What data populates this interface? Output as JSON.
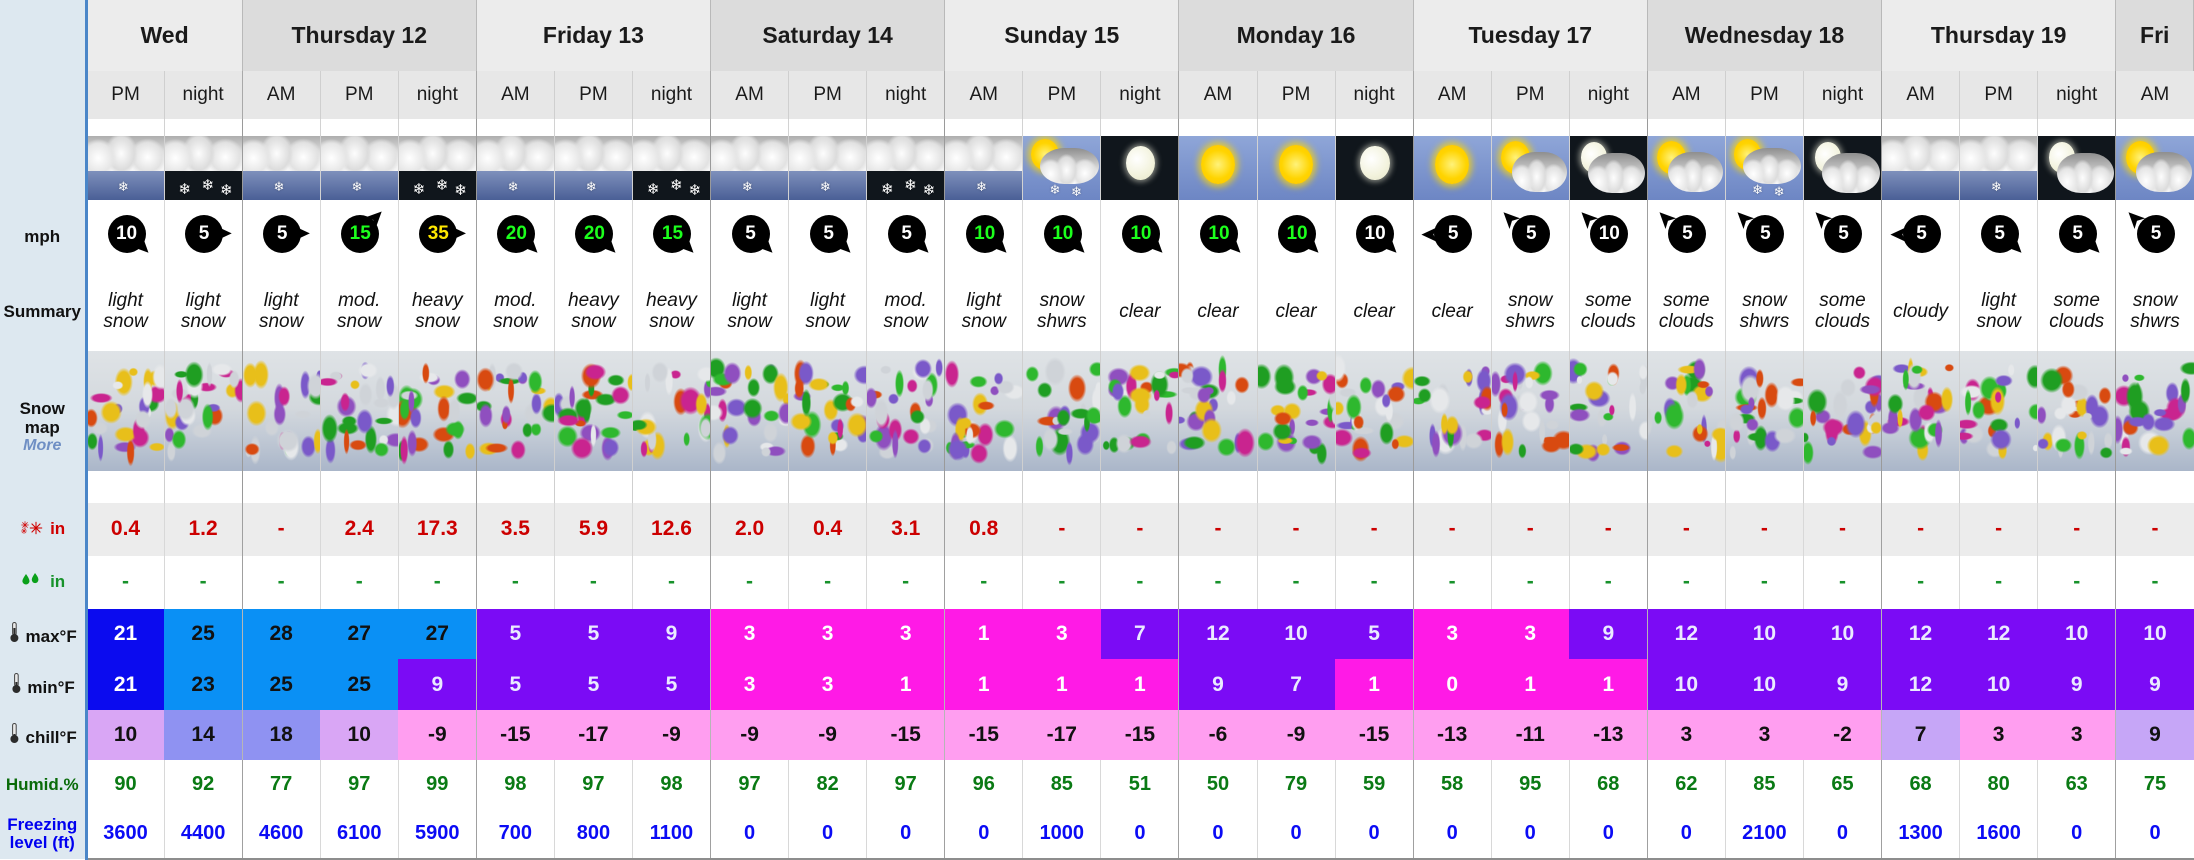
{
  "sidebar": {
    "wind_label": "mph",
    "summary_label": "Summary",
    "snowmap_label": "Snow map",
    "snowmap_more": "More",
    "snow_amount_label": "in",
    "rain_amount_label": "in",
    "max_temp_label": "max°F",
    "min_temp_label": "min°F",
    "chill_label": "chill°F",
    "humidity_label": "Humid.%",
    "freezing_label_1": "Freezing",
    "freezing_label_2": "level (ft)"
  },
  "days": [
    {
      "label": "Wed",
      "span": 2,
      "shade": "a"
    },
    {
      "label": "Thursday 12",
      "span": 3,
      "shade": "b"
    },
    {
      "label": "Friday 13",
      "span": 3,
      "shade": "a"
    },
    {
      "label": "Saturday 14",
      "span": 3,
      "shade": "b"
    },
    {
      "label": "Sunday 15",
      "span": 3,
      "shade": "a"
    },
    {
      "label": "Monday 16",
      "span": 3,
      "shade": "b"
    },
    {
      "label": "Tuesday 17",
      "span": 3,
      "shade": "a"
    },
    {
      "label": "Wednesday 18",
      "span": 3,
      "shade": "b"
    },
    {
      "label": "Thursday 19",
      "span": 3,
      "shade": "a"
    },
    {
      "label": "Fri",
      "span": 1,
      "shade": "b"
    }
  ],
  "columns": [
    {
      "period": "PM",
      "group_start": true,
      "sky": "snow-day",
      "wind": 10,
      "wind_color": "white",
      "wind_dir": "SE",
      "summary": [
        "light",
        "snow"
      ],
      "snow": "0.4",
      "rain": "-",
      "max": 21,
      "min": 21,
      "chill": 10,
      "humid": 90,
      "freeze": 3600,
      "max_bg": "#0b0bef",
      "min_bg": "#0b0bef",
      "max_fg": "#ffffff",
      "min_fg": "#ffffff",
      "chill_bg": "#d9a6f5",
      "chill_fg": "#111111"
    },
    {
      "period": "night",
      "group_start": false,
      "sky": "snow-night",
      "wind": 5,
      "wind_color": "white",
      "wind_dir": "E",
      "summary": [
        "light",
        "snow"
      ],
      "snow": "1.2",
      "rain": "-",
      "max": 25,
      "min": 23,
      "chill": 14,
      "humid": 92,
      "freeze": 4400,
      "max_bg": "#0a90f5",
      "min_bg": "#0a90f5",
      "max_fg": "#111111",
      "min_fg": "#111111",
      "chill_bg": "#8f92f2",
      "chill_fg": "#111111"
    },
    {
      "period": "AM",
      "group_start": true,
      "sky": "snow-day",
      "wind": 5,
      "wind_color": "white",
      "wind_dir": "E",
      "summary": [
        "light",
        "snow"
      ],
      "snow": "-",
      "rain": "-",
      "max": 28,
      "min": 25,
      "chill": 18,
      "humid": 77,
      "freeze": 4600,
      "max_bg": "#0a90f5",
      "min_bg": "#0a90f5",
      "max_fg": "#111111",
      "min_fg": "#111111",
      "chill_bg": "#8f92f2",
      "chill_fg": "#111111"
    },
    {
      "period": "PM",
      "group_start": false,
      "sky": "snow-day",
      "wind": 15,
      "wind_color": "green",
      "wind_dir": "NE",
      "summary": [
        "mod.",
        "snow"
      ],
      "snow": "2.4",
      "rain": "-",
      "max": 27,
      "min": 25,
      "chill": 10,
      "humid": 97,
      "freeze": 6100,
      "max_bg": "#0a90f5",
      "min_bg": "#0a90f5",
      "max_fg": "#111111",
      "min_fg": "#111111",
      "chill_bg": "#d9a6f5",
      "chill_fg": "#111111"
    },
    {
      "period": "night",
      "group_start": false,
      "sky": "snow-night",
      "wind": 35,
      "wind_color": "yellow",
      "wind_dir": "E",
      "summary": [
        "heavy",
        "snow"
      ],
      "snow": "17.3",
      "rain": "-",
      "max": 27,
      "min": 9,
      "chill": -9,
      "humid": 99,
      "freeze": 5900,
      "max_bg": "#0a90f5",
      "min_bg": "#7b0bf5",
      "max_fg": "#111111",
      "min_fg": "#eaeaff",
      "chill_bg": "#ff9ef0",
      "chill_fg": "#111111"
    },
    {
      "period": "AM",
      "group_start": true,
      "sky": "snow-day",
      "wind": 20,
      "wind_color": "green",
      "wind_dir": "SE",
      "summary": [
        "mod.",
        "snow"
      ],
      "snow": "3.5",
      "rain": "-",
      "max": 5,
      "min": 5,
      "chill": -15,
      "humid": 98,
      "freeze": 700,
      "max_bg": "#7b0bf5",
      "min_bg": "#7b0bf5",
      "max_fg": "#eaeaff",
      "min_fg": "#eaeaff",
      "chill_bg": "#ff9ef0",
      "chill_fg": "#111111"
    },
    {
      "period": "PM",
      "group_start": false,
      "sky": "snow-day",
      "wind": 20,
      "wind_color": "green",
      "wind_dir": "SE",
      "summary": [
        "heavy",
        "snow"
      ],
      "snow": "5.9",
      "rain": "-",
      "max": 5,
      "min": 5,
      "chill": -17,
      "humid": 97,
      "freeze": 800,
      "max_bg": "#7b0bf5",
      "min_bg": "#7b0bf5",
      "max_fg": "#eaeaff",
      "min_fg": "#eaeaff",
      "chill_bg": "#ff9ef0",
      "chill_fg": "#111111"
    },
    {
      "period": "night",
      "group_start": false,
      "sky": "snow-night",
      "wind": 15,
      "wind_color": "green",
      "wind_dir": "SE",
      "summary": [
        "heavy",
        "snow"
      ],
      "snow": "12.6",
      "rain": "-",
      "max": 9,
      "min": 5,
      "chill": -9,
      "humid": 98,
      "freeze": 1100,
      "max_bg": "#7b0bf5",
      "min_bg": "#7b0bf5",
      "max_fg": "#eaeaff",
      "min_fg": "#eaeaff",
      "chill_bg": "#ff9ef0",
      "chill_fg": "#111111"
    },
    {
      "period": "AM",
      "group_start": true,
      "sky": "snow-day",
      "wind": 5,
      "wind_color": "white",
      "wind_dir": "SE",
      "summary": [
        "light",
        "snow"
      ],
      "snow": "2.0",
      "rain": "-",
      "max": 3,
      "min": 3,
      "chill": -9,
      "humid": 97,
      "freeze": 0,
      "max_bg": "#ff1ae6",
      "min_bg": "#ff1ae6",
      "max_fg": "#ffffff",
      "min_fg": "#ffffff",
      "chill_bg": "#ff9ef0",
      "chill_fg": "#111111"
    },
    {
      "period": "PM",
      "group_start": false,
      "sky": "snow-day",
      "wind": 5,
      "wind_color": "white",
      "wind_dir": "SE",
      "summary": [
        "light",
        "snow"
      ],
      "snow": "0.4",
      "rain": "-",
      "max": 3,
      "min": 3,
      "chill": -9,
      "humid": 82,
      "freeze": 0,
      "max_bg": "#ff1ae6",
      "min_bg": "#ff1ae6",
      "max_fg": "#ffffff",
      "min_fg": "#ffffff",
      "chill_bg": "#ff9ef0",
      "chill_fg": "#111111"
    },
    {
      "period": "night",
      "group_start": false,
      "sky": "snow-night",
      "wind": 5,
      "wind_color": "white",
      "wind_dir": "SE",
      "summary": [
        "mod.",
        "snow"
      ],
      "snow": "3.1",
      "rain": "-",
      "max": 3,
      "min": 1,
      "chill": -15,
      "humid": 97,
      "freeze": 0,
      "max_bg": "#ff1ae6",
      "min_bg": "#ff1ae6",
      "max_fg": "#ffffff",
      "min_fg": "#ffffff",
      "chill_bg": "#ff9ef0",
      "chill_fg": "#111111"
    },
    {
      "period": "AM",
      "group_start": true,
      "sky": "snow-day",
      "wind": 10,
      "wind_color": "green",
      "wind_dir": "SE",
      "summary": [
        "light",
        "snow"
      ],
      "snow": "0.8",
      "rain": "-",
      "max": 1,
      "min": 1,
      "chill": -15,
      "humid": 96,
      "freeze": 0,
      "max_bg": "#ff1ae6",
      "min_bg": "#ff1ae6",
      "max_fg": "#ffffff",
      "min_fg": "#ffffff",
      "chill_bg": "#ff9ef0",
      "chill_fg": "#111111"
    },
    {
      "period": "PM",
      "group_start": false,
      "sky": "sun-snow",
      "wind": 10,
      "wind_color": "green",
      "wind_dir": "SE",
      "summary": [
        "snow",
        "shwrs"
      ],
      "snow": "-",
      "rain": "-",
      "max": 3,
      "min": 1,
      "chill": -17,
      "humid": 85,
      "freeze": 1000,
      "max_bg": "#ff1ae6",
      "min_bg": "#ff1ae6",
      "max_fg": "#ffffff",
      "min_fg": "#ffffff",
      "chill_bg": "#ff9ef0",
      "chill_fg": "#111111"
    },
    {
      "period": "night",
      "group_start": false,
      "sky": "moon-clear",
      "wind": 10,
      "wind_color": "green",
      "wind_dir": "SE",
      "summary": [
        "clear"
      ],
      "snow": "-",
      "rain": "-",
      "max": 7,
      "min": 1,
      "chill": -15,
      "humid": 51,
      "freeze": 0,
      "max_bg": "#7b0bf5",
      "min_bg": "#ff1ae6",
      "max_fg": "#eaeaff",
      "min_fg": "#ffffff",
      "chill_bg": "#ff9ef0",
      "chill_fg": "#111111"
    },
    {
      "period": "AM",
      "group_start": true,
      "sky": "sun-clear",
      "wind": 10,
      "wind_color": "green",
      "wind_dir": "SE",
      "summary": [
        "clear"
      ],
      "snow": "-",
      "rain": "-",
      "max": 12,
      "min": 9,
      "chill": -6,
      "humid": 50,
      "freeze": 0,
      "max_bg": "#7b0bf5",
      "min_bg": "#7b0bf5",
      "max_fg": "#eaeaff",
      "min_fg": "#eaeaff",
      "chill_bg": "#ff9ef0",
      "chill_fg": "#111111"
    },
    {
      "period": "PM",
      "group_start": false,
      "sky": "sun-clear",
      "wind": 10,
      "wind_color": "green",
      "wind_dir": "SE",
      "summary": [
        "clear"
      ],
      "snow": "-",
      "rain": "-",
      "max": 10,
      "min": 7,
      "chill": -9,
      "humid": 79,
      "freeze": 0,
      "max_bg": "#7b0bf5",
      "min_bg": "#7b0bf5",
      "max_fg": "#eaeaff",
      "min_fg": "#eaeaff",
      "chill_bg": "#ff9ef0",
      "chill_fg": "#111111"
    },
    {
      "period": "night",
      "group_start": false,
      "sky": "moon-clear",
      "wind": 10,
      "wind_color": "white",
      "wind_dir": "SE",
      "summary": [
        "clear"
      ],
      "snow": "-",
      "rain": "-",
      "max": 5,
      "min": 1,
      "chill": -15,
      "humid": 59,
      "freeze": 0,
      "max_bg": "#7b0bf5",
      "min_bg": "#ff1ae6",
      "max_fg": "#eaeaff",
      "min_fg": "#ffffff",
      "chill_bg": "#ff9ef0",
      "chill_fg": "#111111"
    },
    {
      "period": "AM",
      "group_start": true,
      "sky": "sun-clear",
      "wind": 5,
      "wind_color": "white",
      "wind_dir": "W",
      "summary": [
        "clear"
      ],
      "snow": "-",
      "rain": "-",
      "max": 3,
      "min": 0,
      "chill": -13,
      "humid": 58,
      "freeze": 0,
      "max_bg": "#ff1ae6",
      "min_bg": "#ff1ae6",
      "max_fg": "#ffffff",
      "min_fg": "#ffffff",
      "chill_bg": "#ff9ef0",
      "chill_fg": "#111111"
    },
    {
      "period": "PM",
      "group_start": false,
      "sky": "sun-cloud",
      "wind": 5,
      "wind_color": "white",
      "wind_dir": "NW",
      "summary": [
        "snow",
        "shwrs"
      ],
      "snow": "-",
      "rain": "-",
      "max": 3,
      "min": 1,
      "chill": -11,
      "humid": 95,
      "freeze": 0,
      "max_bg": "#ff1ae6",
      "min_bg": "#ff1ae6",
      "max_fg": "#ffffff",
      "min_fg": "#ffffff",
      "chill_bg": "#ff9ef0",
      "chill_fg": "#111111"
    },
    {
      "period": "night",
      "group_start": false,
      "sky": "moon-cloud",
      "wind": 10,
      "wind_color": "white",
      "wind_dir": "NW",
      "summary": [
        "some",
        "clouds"
      ],
      "snow": "-",
      "rain": "-",
      "max": 9,
      "min": 1,
      "chill": -13,
      "humid": 68,
      "freeze": 0,
      "max_bg": "#7b0bf5",
      "min_bg": "#ff1ae6",
      "max_fg": "#eaeaff",
      "min_fg": "#ffffff",
      "chill_bg": "#ff9ef0",
      "chill_fg": "#111111"
    },
    {
      "period": "AM",
      "group_start": true,
      "sky": "sun-cloud",
      "wind": 5,
      "wind_color": "white",
      "wind_dir": "NW",
      "summary": [
        "some",
        "clouds"
      ],
      "snow": "-",
      "rain": "-",
      "max": 12,
      "min": 10,
      "chill": 3,
      "humid": 62,
      "freeze": 0,
      "max_bg": "#7b0bf5",
      "min_bg": "#7b0bf5",
      "max_fg": "#eaeaff",
      "min_fg": "#eaeaff",
      "chill_bg": "#ff9ef0",
      "chill_fg": "#111111"
    },
    {
      "period": "PM",
      "group_start": false,
      "sky": "sun-snow",
      "wind": 5,
      "wind_color": "white",
      "wind_dir": "NW",
      "summary": [
        "snow",
        "shwrs"
      ],
      "snow": "-",
      "rain": "-",
      "max": 10,
      "min": 10,
      "chill": 3,
      "humid": 85,
      "freeze": 2100,
      "max_bg": "#7b0bf5",
      "min_bg": "#7b0bf5",
      "max_fg": "#eaeaff",
      "min_fg": "#eaeaff",
      "chill_bg": "#ff9ef0",
      "chill_fg": "#111111"
    },
    {
      "period": "night",
      "group_start": false,
      "sky": "moon-cloud",
      "wind": 5,
      "wind_color": "white",
      "wind_dir": "NW",
      "summary": [
        "some",
        "clouds"
      ],
      "snow": "-",
      "rain": "-",
      "max": 10,
      "min": 9,
      "chill": -2,
      "humid": 65,
      "freeze": 0,
      "max_bg": "#7b0bf5",
      "min_bg": "#7b0bf5",
      "max_fg": "#eaeaff",
      "min_fg": "#eaeaff",
      "chill_bg": "#ff9ef0",
      "chill_fg": "#111111"
    },
    {
      "period": "AM",
      "group_start": true,
      "sky": "cloudy",
      "wind": 5,
      "wind_color": "white",
      "wind_dir": "W",
      "summary": [
        "cloudy"
      ],
      "snow": "-",
      "rain": "-",
      "max": 12,
      "min": 12,
      "chill": 7,
      "humid": 68,
      "freeze": 1300,
      "max_bg": "#7b0bf5",
      "min_bg": "#7b0bf5",
      "max_fg": "#eaeaff",
      "min_fg": "#eaeaff",
      "chill_bg": "#c6a6f7",
      "chill_fg": "#111111"
    },
    {
      "period": "PM",
      "group_start": false,
      "sky": "snow-day",
      "wind": 5,
      "wind_color": "white",
      "wind_dir": "SE",
      "summary": [
        "light",
        "snow"
      ],
      "snow": "-",
      "rain": "-",
      "max": 12,
      "min": 10,
      "chill": 3,
      "humid": 80,
      "freeze": 1600,
      "max_bg": "#7b0bf5",
      "min_bg": "#7b0bf5",
      "max_fg": "#eaeaff",
      "min_fg": "#eaeaff",
      "chill_bg": "#ff9ef0",
      "chill_fg": "#111111"
    },
    {
      "period": "night",
      "group_start": false,
      "sky": "moon-cloud",
      "wind": 5,
      "wind_color": "white",
      "wind_dir": "SE",
      "summary": [
        "some",
        "clouds"
      ],
      "snow": "-",
      "rain": "-",
      "max": 10,
      "min": 9,
      "chill": 3,
      "humid": 63,
      "freeze": 0,
      "max_bg": "#7b0bf5",
      "min_bg": "#7b0bf5",
      "max_fg": "#eaeaff",
      "min_fg": "#eaeaff",
      "chill_bg": "#ff9ef0",
      "chill_fg": "#111111"
    },
    {
      "period": "AM",
      "group_start": true,
      "sky": "sun-cloud",
      "wind": 5,
      "wind_color": "white",
      "wind_dir": "NW",
      "summary": [
        "snow",
        "shwrs"
      ],
      "snow": "-",
      "rain": "-",
      "max": 10,
      "min": 9,
      "chill": 9,
      "humid": 75,
      "freeze": 0,
      "max_bg": "#7b0bf5",
      "min_bg": "#7b0bf5",
      "max_fg": "#eaeaff",
      "min_fg": "#eaeaff",
      "chill_bg": "#c6a6f7",
      "chill_fg": "#111111"
    }
  ]
}
